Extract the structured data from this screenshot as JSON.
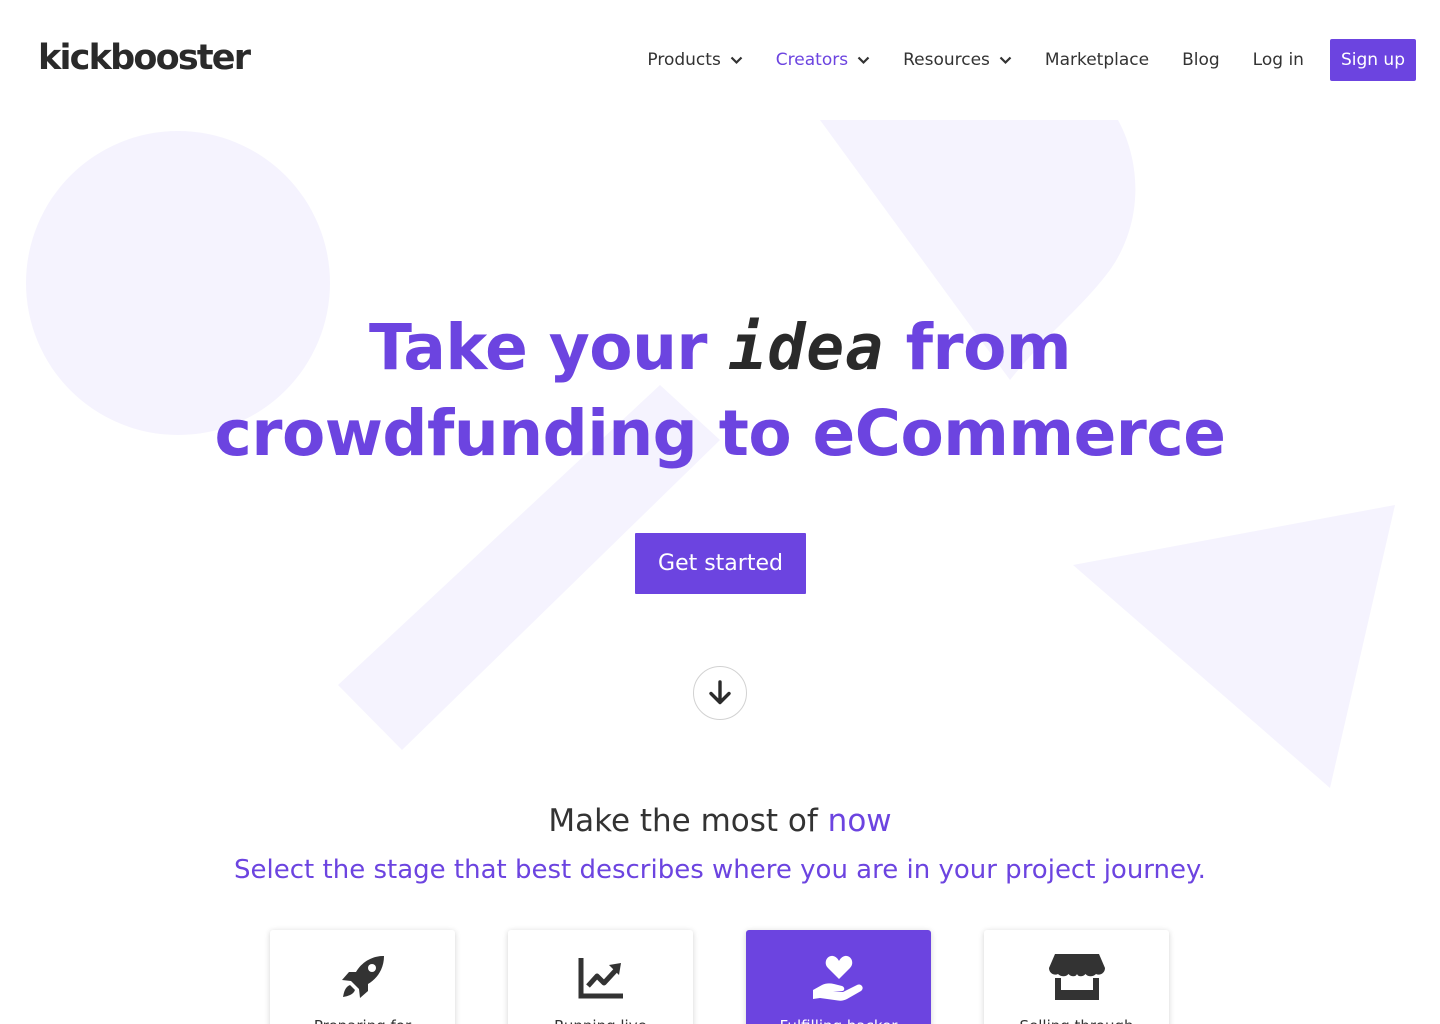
{
  "brand": {
    "logo_text": "kickbooster",
    "accent_color": "#6c44e0"
  },
  "nav": {
    "items": [
      {
        "label": "Products",
        "has_dropdown": true,
        "active": false
      },
      {
        "label": "Creators",
        "has_dropdown": true,
        "active": true
      },
      {
        "label": "Resources",
        "has_dropdown": true,
        "active": false
      },
      {
        "label": "Marketplace",
        "has_dropdown": false,
        "active": false
      },
      {
        "label": "Blog",
        "has_dropdown": false,
        "active": false
      },
      {
        "label": "Log in",
        "has_dropdown": false,
        "active": false
      }
    ],
    "signup_label": "Sign up"
  },
  "hero": {
    "line1_part1": "Take your ",
    "line1_highlight": "idea",
    "line1_part2": " from",
    "line2": "crowdfunding to eCommerce",
    "cta_label": "Get started",
    "scroll_icon": "arrow-down-icon"
  },
  "stage_section": {
    "title_part1": "Make the most of ",
    "title_accent": "now",
    "subtitle": "Select the stage that best describes where you are in your project journey.",
    "cards": [
      {
        "label": "Preparing for",
        "icon": "rocket-icon",
        "active": false
      },
      {
        "label": "Running live",
        "icon": "chart-line-icon",
        "active": false
      },
      {
        "label": "Fulfilling backer",
        "icon": "hand-heart-icon",
        "active": true
      },
      {
        "label": "Selling through",
        "icon": "storefront-icon",
        "active": false
      }
    ]
  }
}
